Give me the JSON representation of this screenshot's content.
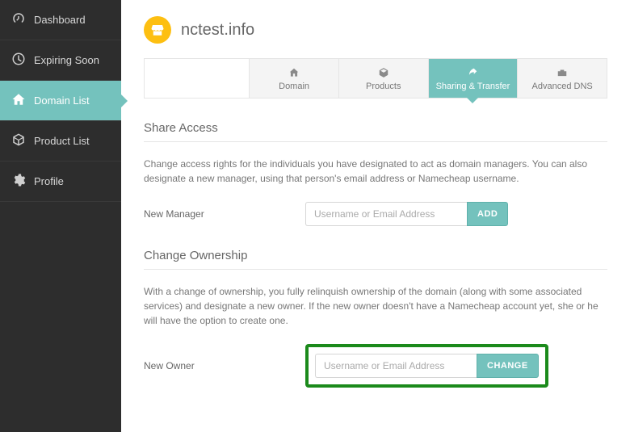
{
  "sidebar": {
    "items": [
      {
        "label": "Dashboard"
      },
      {
        "label": "Expiring Soon"
      },
      {
        "label": "Domain List"
      },
      {
        "label": "Product List"
      },
      {
        "label": "Profile"
      }
    ]
  },
  "header": {
    "domain_name": "nctest.info"
  },
  "tabs": [
    {
      "label": "Domain"
    },
    {
      "label": "Products"
    },
    {
      "label": "Sharing & Transfer"
    },
    {
      "label": "Advanced DNS"
    }
  ],
  "share_access": {
    "title": "Share Access",
    "description": "Change access rights for the individuals you have designated to act as domain managers. You can also designate a new manager, using that person's email address or Namecheap username.",
    "field_label": "New Manager",
    "placeholder": "Username or Email Address",
    "button_label": "ADD"
  },
  "change_ownership": {
    "title": "Change Ownership",
    "description": "With a change of ownership, you fully relinquish ownership of the domain (along with some associated services) and designate a new owner. If the new owner doesn't have a Namecheap account yet, she or he will have the option to create one.",
    "field_label": "New Owner",
    "placeholder": "Username or Email Address",
    "button_label": "CHANGE"
  }
}
